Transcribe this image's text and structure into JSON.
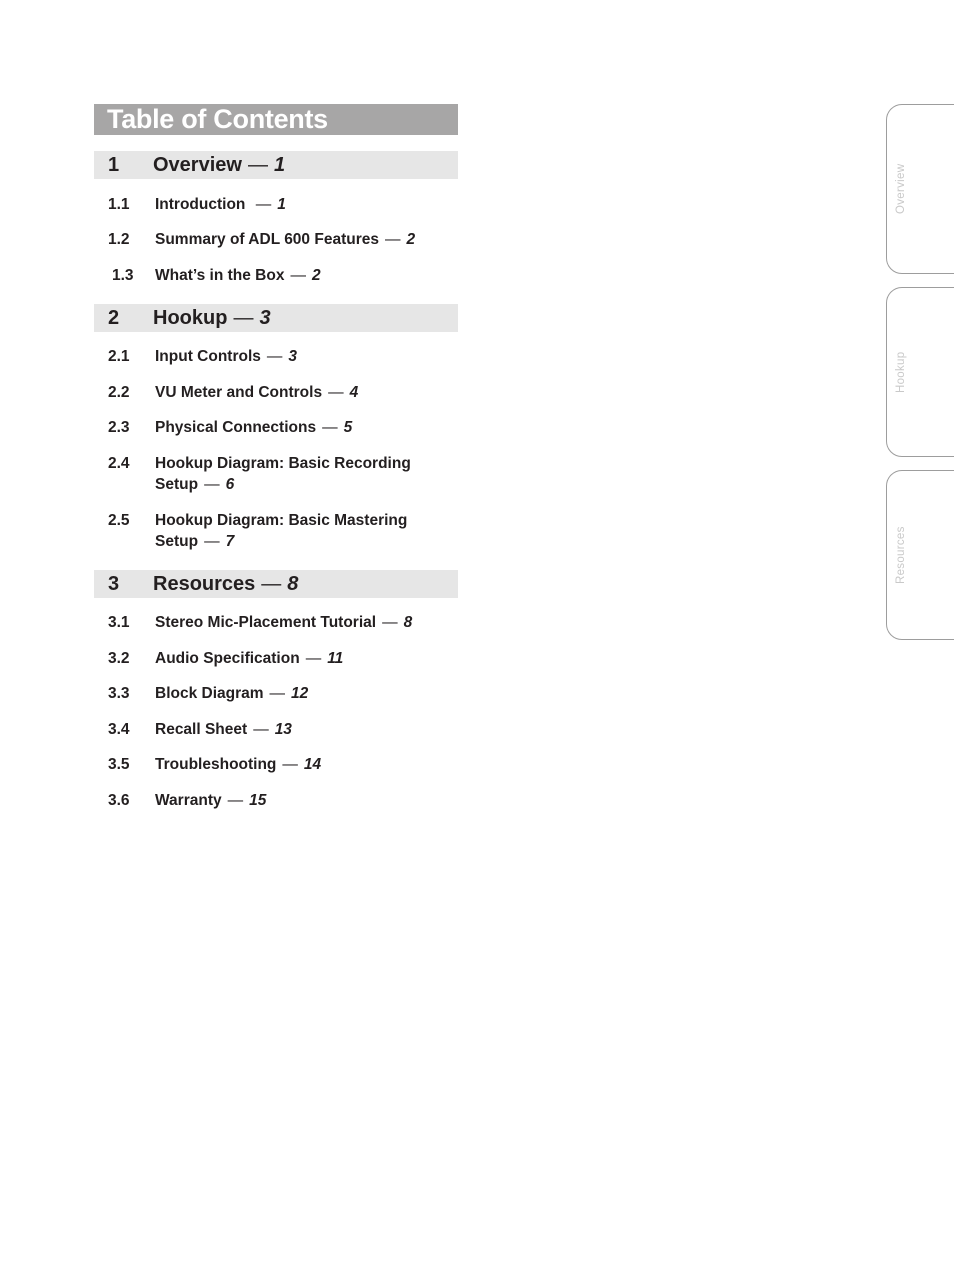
{
  "title": "Table of Contents",
  "sections": [
    {
      "number": "1",
      "label": "Overview",
      "page": "1",
      "items": [
        {
          "number": "1.1",
          "label": "Introduction",
          "page": "1"
        },
        {
          "number": "1.2",
          "label": "Summary of ADL 600 Features",
          "page": "2"
        },
        {
          "number": "1.3",
          "label": "What’s in the Box",
          "page": "2"
        }
      ]
    },
    {
      "number": "2",
      "label": "Hookup",
      "page": "3",
      "items": [
        {
          "number": "2.1",
          "label": "Input Controls",
          "page": "3"
        },
        {
          "number": "2.2",
          "label": "VU Meter and Controls",
          "page": "4"
        },
        {
          "number": "2.3",
          "label": "Physical Connections",
          "page": "5"
        },
        {
          "number": "2.4",
          "label": "Hookup Diagram: Basic Recording Setup",
          "page": "6"
        },
        {
          "number": "2.5",
          "label": "Hookup Diagram: Basic Mastering Setup",
          "page": "7"
        }
      ]
    },
    {
      "number": "3",
      "label": "Resources",
      "page": "8",
      "items": [
        {
          "number": "3.1",
          "label": "Stereo Mic-Placement Tutorial",
          "page": "8"
        },
        {
          "number": "3.2",
          "label": "Audio Specification",
          "page": "11"
        },
        {
          "number": "3.3",
          "label": "Block Diagram",
          "page": "12"
        },
        {
          "number": "3.4",
          "label": "Recall Sheet",
          "page": "13"
        },
        {
          "number": "3.5",
          "label": "Troubleshooting",
          "page": "14"
        },
        {
          "number": "3.6",
          "label": "Warranty",
          "page": "15"
        }
      ]
    }
  ],
  "dash": "—",
  "side_tabs": [
    "Overview",
    "Hookup",
    "Resources"
  ],
  "colors": {
    "title_bar": "#a7a6a6",
    "section_bar": "#e6e6e6",
    "tab_text": "#c9c9c9"
  }
}
